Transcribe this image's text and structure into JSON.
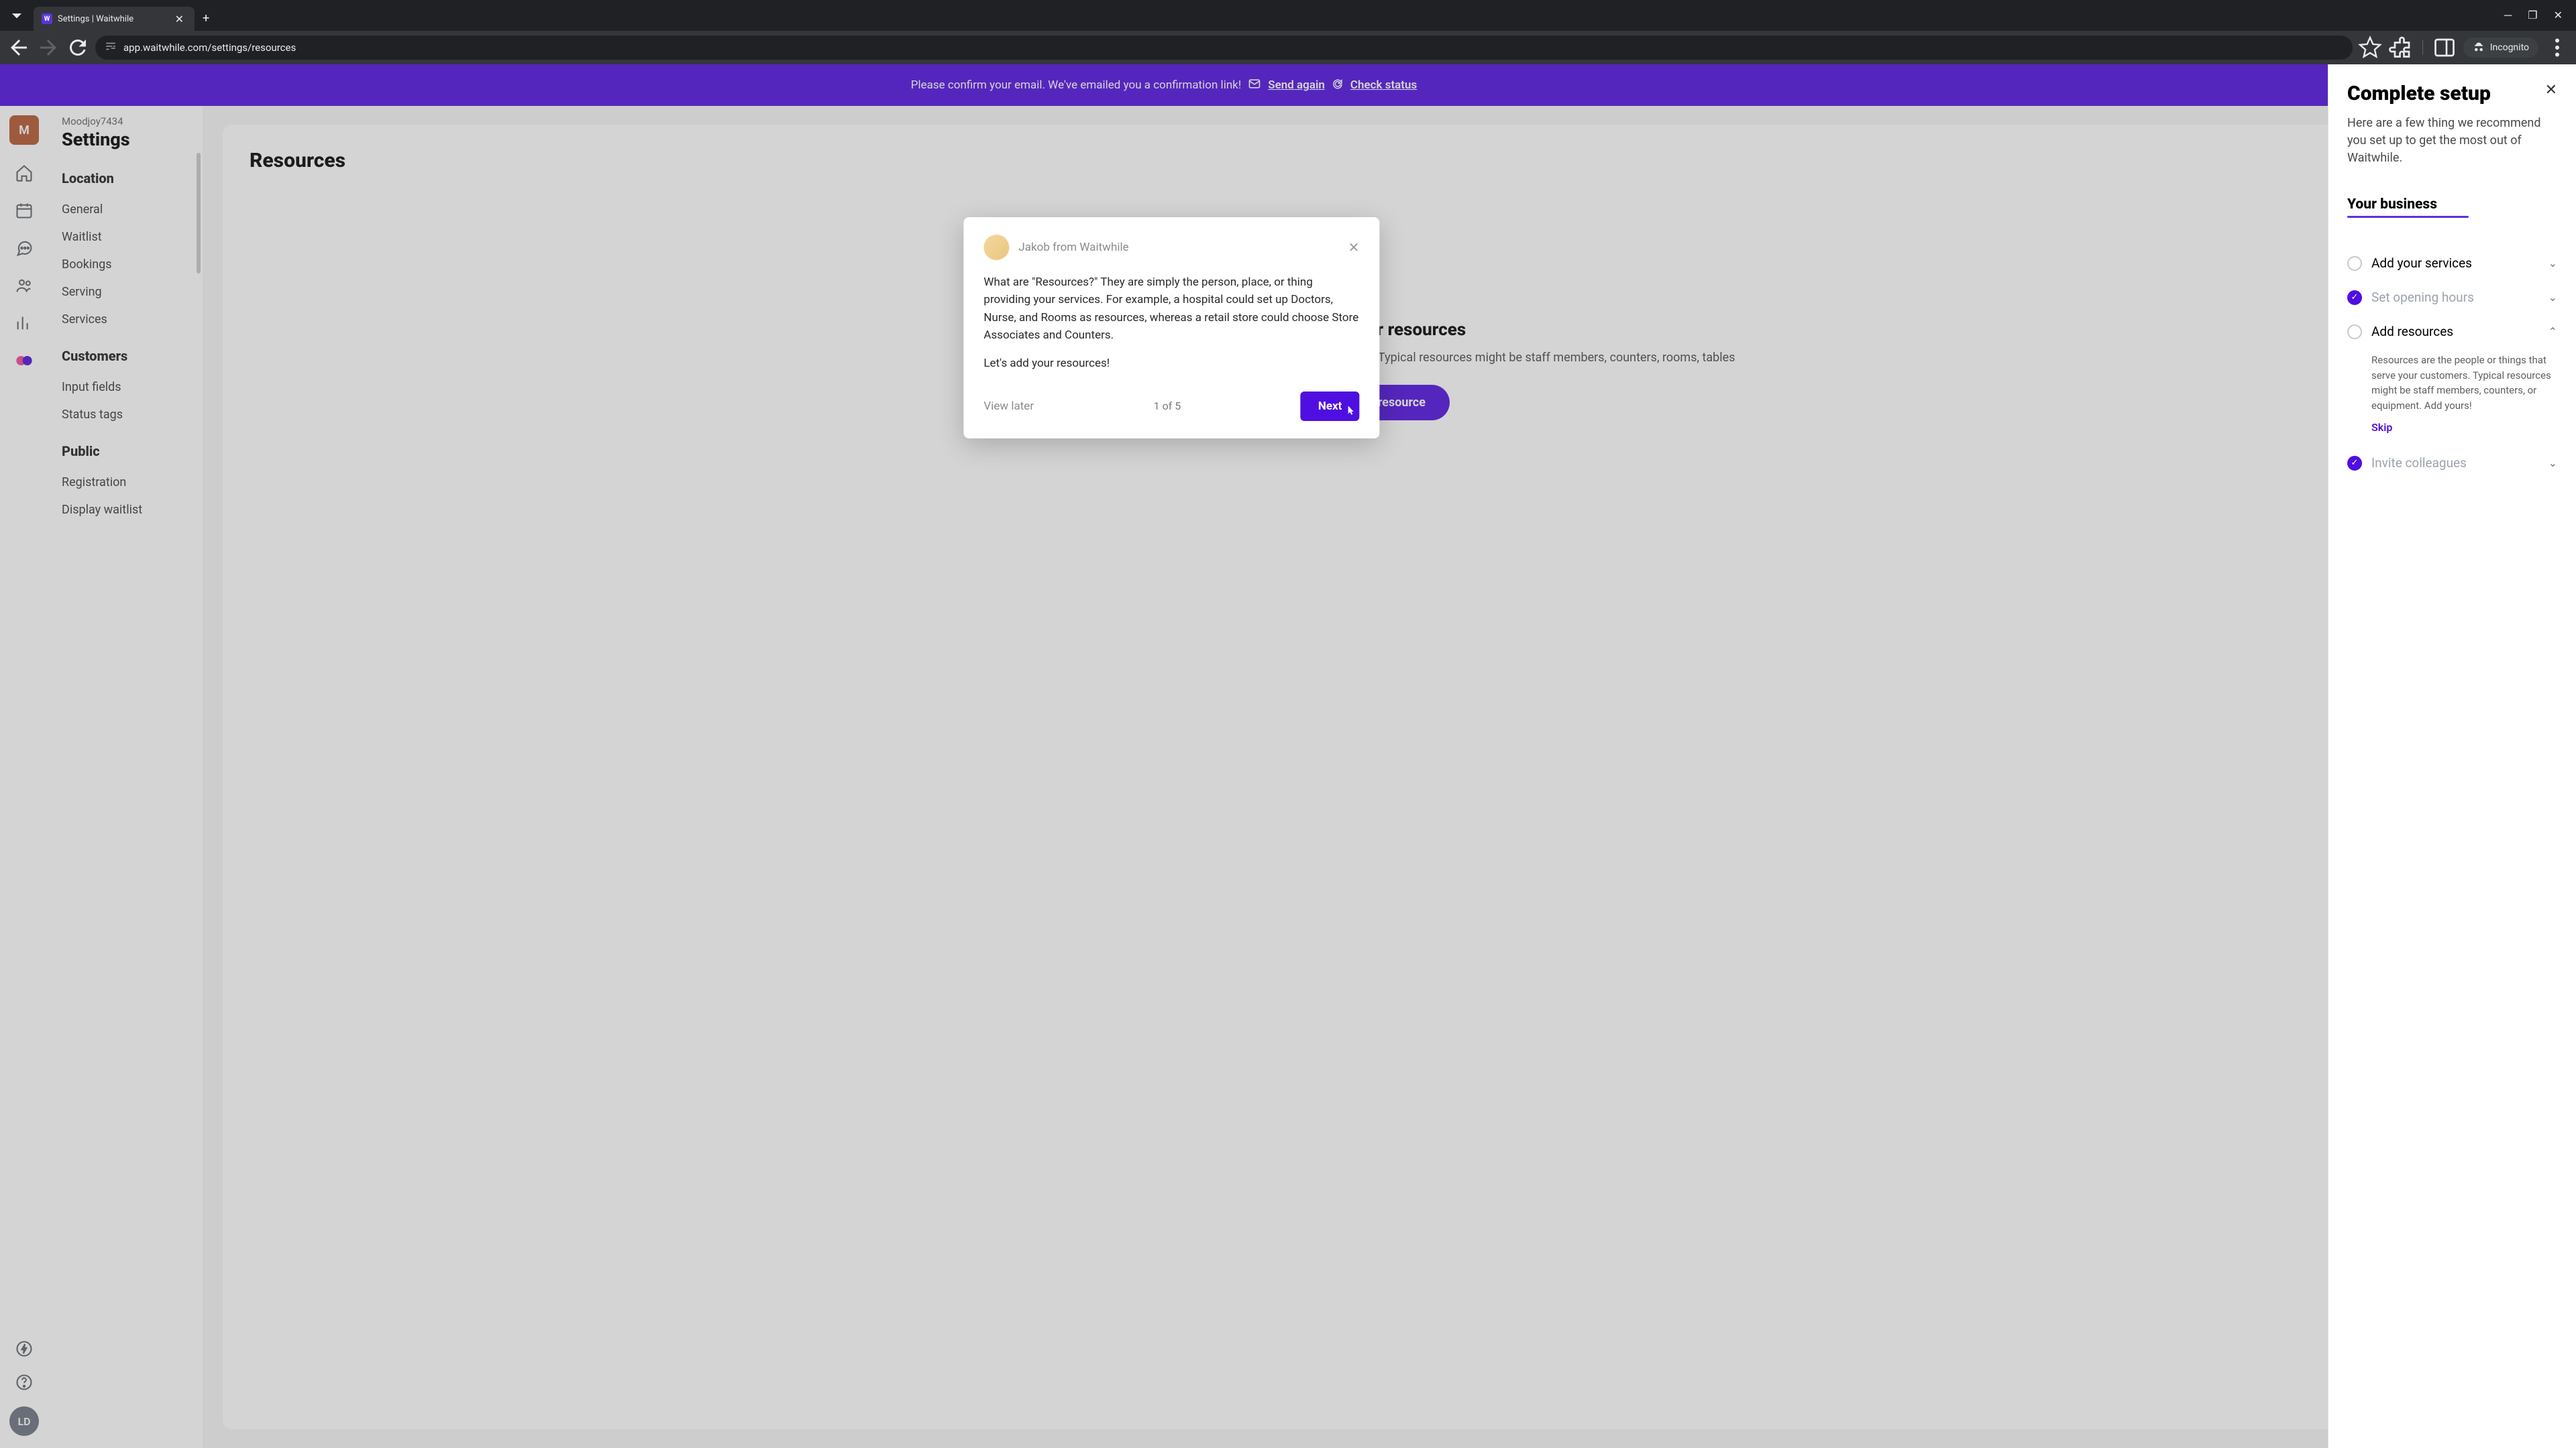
{
  "browser": {
    "tab_title": "Settings | Waitwhile",
    "url": "app.waitwhile.com/settings/resources",
    "incognito_label": "Incognito"
  },
  "banner": {
    "text": "Please confirm your email. We've emailed you a confirmation link!",
    "send_again": "Send again",
    "check_status": "Check status"
  },
  "left_rail": {
    "avatar_letter": "M",
    "user_initials": "LD"
  },
  "sidebar": {
    "org": "Moodjoy7434",
    "title": "Settings",
    "sections": [
      {
        "heading": "Location",
        "items": [
          "General",
          "Waitlist",
          "Bookings",
          "Serving",
          "Services"
        ]
      },
      {
        "heading": "Customers",
        "items": [
          "Input fields",
          "Status tags"
        ]
      },
      {
        "heading": "Public",
        "items": [
          "Registration",
          "Display waitlist"
        ]
      }
    ]
  },
  "main": {
    "heading": "Resources",
    "empty_title": "Add your resources",
    "empty_desc": "Resources are the people or things that serve your customers. Typical resources might be staff members, counters, rooms, tables",
    "add_button": "Add resource"
  },
  "modal": {
    "from": "Jakob from Waitwhile",
    "body1": "What are \"Resources?\" They are simply the person, place, or thing providing your services. For example, a hospital could set up Doctors, Nurse, and Rooms as resources, whereas a retail store could choose Store Associates and Counters.",
    "body2": "Let's add your resources!",
    "view_later": "View later",
    "step": "1 of 5",
    "next": "Next"
  },
  "panel": {
    "title": "Complete setup",
    "sub": "Here are a few thing we recommend you set up to get the most out of Waitwhile.",
    "section": "Your business",
    "items": [
      {
        "label": "Add your services",
        "done": false,
        "expanded": false
      },
      {
        "label": "Set opening hours",
        "done": true,
        "expanded": false
      },
      {
        "label": "Add resources",
        "done": false,
        "expanded": true,
        "detail": "Resources are the people or things that serve your customers. Typical resources might be staff members, counters, or equipment. Add yours!",
        "skip": "Skip"
      },
      {
        "label": "Invite colleagues",
        "done": true,
        "expanded": false
      }
    ]
  }
}
